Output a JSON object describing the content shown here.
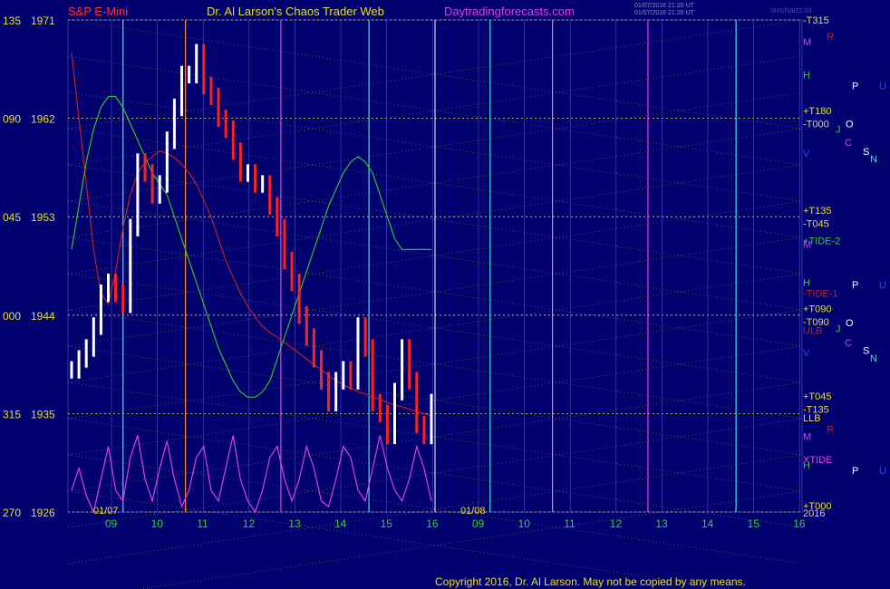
{
  "header": {
    "instrument": "S&P E-Mini",
    "site_title": "Dr. Al Larson's Chaos Trader Web",
    "site_url": "Daytradingforecasts.com",
    "timestamp_1": "01/07/2016 21:20 UT",
    "timestamp_2": "01/07/2016 21:20 UT",
    "software": "sixcharts.td"
  },
  "footer": {
    "copyright": "Copyright 2016, Dr. Al Larson. May not be copied by any means."
  },
  "colors": {
    "background": "#00006e",
    "price_up": "#ffffff",
    "price_down": "#ff2020",
    "grid_gold": "#e8e020",
    "cyan": "#40e0e0",
    "magenta": "#e040e0",
    "green": "#30c030",
    "red": "#c02020"
  },
  "chart_data": {
    "type": "line",
    "title": "S&P E-Mini",
    "y_labels": [
      {
        "left": "135",
        "price": "1971",
        "value": 1971
      },
      {
        "left": "090",
        "price": "1962",
        "value": 1962
      },
      {
        "left": "045",
        "price": "1953",
        "value": 1953
      },
      {
        "left": "000",
        "price": "1944",
        "value": 1944
      },
      {
        "left": "315",
        "price": "1935",
        "value": 1935
      },
      {
        "left": "270",
        "price": "1926",
        "value": 1926
      }
    ],
    "ylim": [
      1926,
      1971
    ],
    "panels": [
      {
        "date": "01/07",
        "hours": [
          "09",
          "10",
          "11",
          "12",
          "13",
          "14",
          "15",
          "16"
        ]
      },
      {
        "date": "01/08",
        "hours": [
          "09",
          "10",
          "11",
          "12",
          "13",
          "14",
          "15",
          "16"
        ]
      }
    ],
    "right_labels": [
      {
        "text": "-T315",
        "v": 1971
      },
      {
        "text": "M",
        "v": 1969
      },
      {
        "text": "R",
        "v": 1969.5
      },
      {
        "text": "H",
        "v": 1966
      },
      {
        "text": "P",
        "v": 1965
      },
      {
        "text": "U",
        "v": 1965
      },
      {
        "text": "+T180",
        "v": 1962.7
      },
      {
        "text": "-T000",
        "v": 1961.5
      },
      {
        "text": "J",
        "v": 1961
      },
      {
        "text": "O",
        "v": 1961.5
      },
      {
        "text": "C",
        "v": 1959.8
      },
      {
        "text": "V",
        "v": 1958.8
      },
      {
        "text": "S",
        "v": 1959
      },
      {
        "text": "N",
        "v": 1958.3
      },
      {
        "text": "+T135",
        "v": 1953.6
      },
      {
        "text": "-T045",
        "v": 1952.4
      },
      {
        "text": "M",
        "v": 1950.5
      },
      {
        "text": "+TIDE-2",
        "v": 1950.8
      },
      {
        "text": "H",
        "v": 1947
      },
      {
        "text": "P",
        "v": 1946.8
      },
      {
        "text": "U",
        "v": 1946.8
      },
      {
        "text": "-TIDE-1",
        "v": 1946
      },
      {
        "text": "+T090",
        "v": 1944.6
      },
      {
        "text": "-T090",
        "v": 1943.4
      },
      {
        "text": "ULB",
        "v": 1942.6
      },
      {
        "text": "J",
        "v": 1942.8
      },
      {
        "text": "O",
        "v": 1943.3
      },
      {
        "text": "C",
        "v": 1941.5
      },
      {
        "text": "V",
        "v": 1940.6
      },
      {
        "text": "S",
        "v": 1940.8
      },
      {
        "text": "N",
        "v": 1940.1
      },
      {
        "text": "+T045",
        "v": 1936.6
      },
      {
        "text": "-T135",
        "v": 1935.4
      },
      {
        "text": "LLB",
        "v": 1934.6
      },
      {
        "text": "R",
        "v": 1933.6
      },
      {
        "text": "M",
        "v": 1932.9
      },
      {
        "text": "XTIDE",
        "v": 1930.8
      },
      {
        "text": "H",
        "v": 1930.3
      },
      {
        "text": "P",
        "v": 1929.8
      },
      {
        "text": "U",
        "v": 1929.8
      },
      {
        "text": "+T000",
        "v": 1926.6
      },
      {
        "text": "2016",
        "v": 1925.9
      }
    ],
    "series": [
      {
        "name": "price",
        "values": [
          1939,
          1940,
          1941,
          1943,
          1946,
          1947,
          1946,
          1945,
          1952,
          1958,
          1957,
          1955,
          1956,
          1960,
          1963,
          1966,
          1966,
          1968,
          1965,
          1964,
          1962,
          1961,
          1959,
          1957,
          1957,
          1956,
          1956,
          1954,
          1952,
          1949,
          1947,
          1944,
          1942,
          1940,
          1938,
          1936,
          1938,
          1939,
          1938,
          1943,
          1941,
          1936,
          1935,
          1933,
          1937,
          1941,
          1938,
          1934,
          1933,
          1936
        ]
      },
      {
        "name": "TIDE-1",
        "values": [
          1968,
          1962,
          1956,
          1950,
          1946,
          1945,
          1948,
          1952,
          1955,
          1957,
          1958,
          1958.5,
          1959,
          1958.8,
          1958.4,
          1957.8,
          1957,
          1956,
          1954.5,
          1953,
          1951,
          1949,
          1947.5,
          1946,
          1944.8,
          1943.8,
          1943,
          1942.4,
          1942,
          1941.5,
          1941,
          1940.5,
          1940,
          1939.5,
          1939,
          1938.5,
          1938,
          1937.6,
          1937.3,
          1937,
          1936.8,
          1936.5,
          1936.3,
          1936,
          1935.8,
          1935.6,
          1935.4,
          1935.2,
          1935,
          1934.8
        ]
      },
      {
        "name": "TIDE-2",
        "values": [
          1950,
          1954,
          1958,
          1961,
          1963,
          1964,
          1964,
          1963,
          1961.5,
          1960,
          1958.5,
          1957,
          1956,
          1955,
          1953,
          1951,
          1949,
          1947,
          1945,
          1943,
          1941,
          1939.5,
          1938,
          1937,
          1936.5,
          1936.5,
          1937,
          1938,
          1940,
          1942,
          1944,
          1946,
          1948,
          1950,
          1952,
          1954,
          1955.5,
          1957,
          1958,
          1958.5,
          1958,
          1957,
          1955,
          1953,
          1951,
          1950,
          1950,
          1950,
          1950,
          1950
        ]
      },
      {
        "name": "XTIDE",
        "values": [
          1928,
          1930,
          1927.5,
          1926,
          1929,
          1932,
          1928,
          1927,
          1931,
          1933,
          1929,
          1927,
          1930,
          1932.5,
          1929,
          1926.5,
          1928,
          1931,
          1932,
          1928,
          1927,
          1930,
          1933,
          1929,
          1927,
          1926,
          1928,
          1931,
          1932,
          1929,
          1927,
          1929,
          1932,
          1930,
          1927,
          1926.5,
          1929,
          1932,
          1931,
          1928,
          1927,
          1930,
          1933,
          1930,
          1928,
          1927,
          1929,
          1932,
          1930,
          1927
        ]
      }
    ]
  }
}
